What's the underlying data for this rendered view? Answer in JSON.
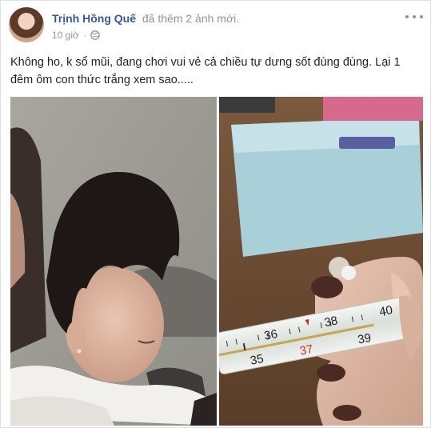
{
  "post": {
    "author": "Trịnh Hồng Quế",
    "action": "đã thêm 2 ảnh mới.",
    "time": "10 giờ",
    "privacy_icon": "globe-icon",
    "menu_icon": "more-options-icon",
    "text": "Không ho, k sổ mũi, đang chơi vui vẻ cả chiều tự dưng sốt đùng đùng. Lại 1 đêm ôm con thức trắng xem sao....."
  },
  "thermometer": {
    "scale_top": [
      "36",
      "38",
      "40"
    ],
    "scale_bottom": [
      "35",
      "37",
      "39"
    ]
  },
  "colors": {
    "author_link": "#365899",
    "meta_text": "#90949c",
    "body_text": "#1d2129"
  }
}
